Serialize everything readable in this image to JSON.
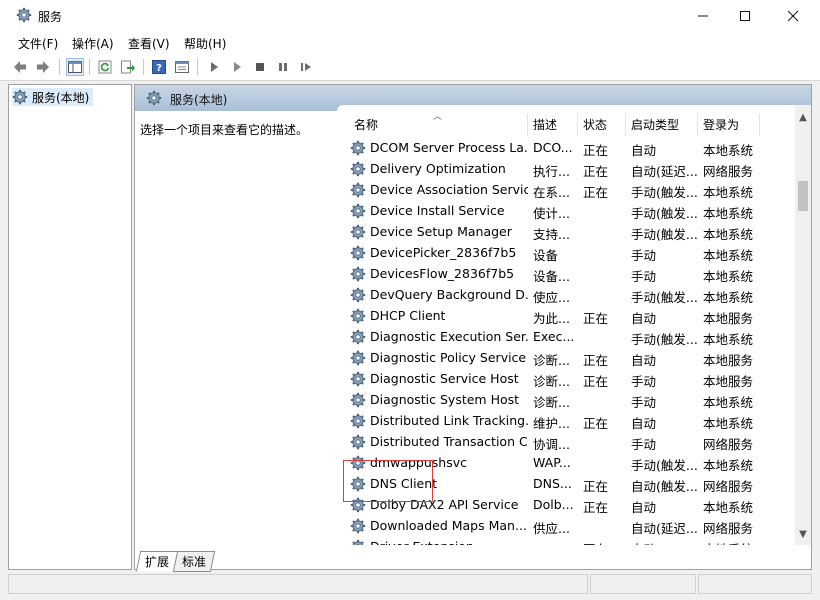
{
  "window": {
    "title": "服务"
  },
  "menu": [
    "文件(F)",
    "操作(A)",
    "查看(V)",
    "帮助(H)"
  ],
  "tree": {
    "root": "服务(本地)"
  },
  "content": {
    "title": "服务(本地)",
    "description_hint": "选择一个项目来查看它的描述。"
  },
  "columns": {
    "name": "名称",
    "desc": "描述",
    "status": "状态",
    "startup": "启动类型",
    "logon": "登录为"
  },
  "services": [
    {
      "name": "DCOM Server Process La...",
      "desc": "DCO...",
      "status": "正在",
      "startup": "自动",
      "logon": "本地系统"
    },
    {
      "name": "Delivery Optimization",
      "desc": "执行...",
      "status": "正在",
      "startup": "自动(延迟...",
      "logon": "网络服务"
    },
    {
      "name": "Device Association Service",
      "desc": "在系...",
      "status": "正在",
      "startup": "手动(触发...",
      "logon": "本地系统"
    },
    {
      "name": "Device Install Service",
      "desc": "使计...",
      "status": "",
      "startup": "手动(触发...",
      "logon": "本地系统"
    },
    {
      "name": "Device Setup Manager",
      "desc": "支持...",
      "status": "",
      "startup": "手动(触发...",
      "logon": "本地系统"
    },
    {
      "name": "DevicePicker_2836f7b5",
      "desc": "设备",
      "status": "",
      "startup": "手动",
      "logon": "本地系统"
    },
    {
      "name": "DevicesFlow_2836f7b5",
      "desc": "设备...",
      "status": "",
      "startup": "手动",
      "logon": "本地系统"
    },
    {
      "name": "DevQuery Background D...",
      "desc": "使应...",
      "status": "",
      "startup": "手动(触发...",
      "logon": "本地系统"
    },
    {
      "name": "DHCP Client",
      "desc": "为此...",
      "status": "正在",
      "startup": "自动",
      "logon": "本地服务"
    },
    {
      "name": "Diagnostic Execution Ser...",
      "desc": "Exec...",
      "status": "",
      "startup": "手动(触发...",
      "logon": "本地系统"
    },
    {
      "name": "Diagnostic Policy Service",
      "desc": "诊断...",
      "status": "正在",
      "startup": "自动",
      "logon": "本地服务"
    },
    {
      "name": "Diagnostic Service Host",
      "desc": "诊断...",
      "status": "正在",
      "startup": "手动",
      "logon": "本地服务"
    },
    {
      "name": "Diagnostic System Host",
      "desc": "诊断...",
      "status": "",
      "startup": "手动",
      "logon": "本地系统"
    },
    {
      "name": "Distributed Link Tracking...",
      "desc": "维护...",
      "status": "正在",
      "startup": "自动",
      "logon": "本地系统"
    },
    {
      "name": "Distributed Transaction C...",
      "desc": "协调...",
      "status": "",
      "startup": "手动",
      "logon": "网络服务"
    },
    {
      "name": "dmwappushsvc",
      "desc": "WAP...",
      "status": "",
      "startup": "手动(触发...",
      "logon": "本地系统"
    },
    {
      "name": "DNS Client",
      "desc": "DNS...",
      "status": "正在",
      "startup": "自动(触发...",
      "logon": "网络服务"
    },
    {
      "name": "Dolby DAX2 API Service",
      "desc": "Dolb...",
      "status": "正在",
      "startup": "自动",
      "logon": "本地系统"
    },
    {
      "name": "Downloaded Maps Man...",
      "desc": "供应...",
      "status": "",
      "startup": "自动(延迟...",
      "logon": "网络服务"
    },
    {
      "name": "Driver Extension",
      "desc": "",
      "status": "正在",
      "startup": "自动",
      "logon": "本地系统"
    }
  ],
  "tabs": {
    "extended": "扩展",
    "standard": "标准"
  },
  "icons": {
    "app": "gear-icon",
    "back": "arrow-left-icon",
    "forward": "arrow-right-icon",
    "console_tree": "console-tree-icon",
    "refresh": "refresh-icon",
    "export": "export-icon",
    "help": "help-icon",
    "properties": "properties-icon",
    "start": "play-icon",
    "start_alt": "play-outline-icon",
    "stop": "stop-icon",
    "pause": "pause-icon",
    "restart": "restart-icon"
  },
  "colors": {
    "highlight": "#e03a3a",
    "header_bar": "#a9bfd6",
    "selection": "#dcebfa"
  }
}
